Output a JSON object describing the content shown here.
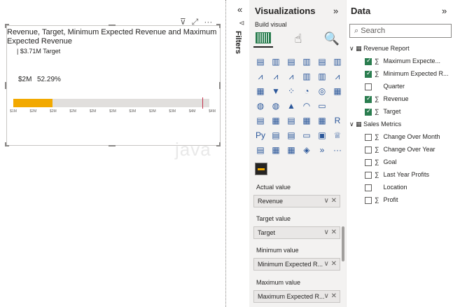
{
  "visual": {
    "header_icons": [
      "filter-icon",
      "focus-mode-icon",
      "more-options-icon"
    ],
    "title": "Revenue, Target, Minimum Expected Revenue and Maximum Expected Revenue",
    "target_label": "| $3.71M Target",
    "value_label": "$2M",
    "percent_label": "52.29%",
    "progress_fraction": 0.2,
    "target_fraction": 0.965,
    "axis_ticks": [
      "$1M",
      "$2M",
      "$2M",
      "$2M",
      "$2M",
      "$3M",
      "$3M",
      "$3M",
      "$3M",
      "$4M",
      "$4M"
    ],
    "watermark": "java"
  },
  "filters": {
    "collapse": "«",
    "label": "Filters"
  },
  "visualizations": {
    "title": "Visualizations",
    "expand": "»",
    "build_visual": "Build visual",
    "wells": [
      {
        "label": "Actual value",
        "value": "Revenue"
      },
      {
        "label": "Target value",
        "value": "Target"
      },
      {
        "label": "Minimum value",
        "value": "Minimum Expected R..."
      },
      {
        "label": "Maximum value",
        "value": "Maximum Expected R..."
      }
    ]
  },
  "data": {
    "title": "Data",
    "expand": "»",
    "search_placeholder": "Search",
    "tables": [
      {
        "name": "Revenue Report",
        "fields": [
          {
            "name": "Maximum Expecte...",
            "checked": true,
            "sigma": true
          },
          {
            "name": "Minimum Expected R...",
            "checked": true,
            "sigma": true
          },
          {
            "name": "Quarter",
            "checked": false,
            "sigma": false
          },
          {
            "name": "Revenue",
            "checked": true,
            "sigma": true
          },
          {
            "name": "Target",
            "checked": true,
            "sigma": true
          }
        ]
      },
      {
        "name": "Sales Metrics",
        "fields": [
          {
            "name": "Change Over Month",
            "checked": false,
            "sigma": true
          },
          {
            "name": "Change Over Year",
            "checked": false,
            "sigma": true
          },
          {
            "name": "Goal",
            "checked": false,
            "sigma": true
          },
          {
            "name": "Last Year Profits",
            "checked": false,
            "sigma": true
          },
          {
            "name": "Location",
            "checked": false,
            "sigma": false
          },
          {
            "name": "Profit",
            "checked": false,
            "sigma": true
          }
        ]
      }
    ]
  },
  "colors": {
    "accent": "#f2a900",
    "target": "#c4314b",
    "selected": "#2a7d4f"
  }
}
